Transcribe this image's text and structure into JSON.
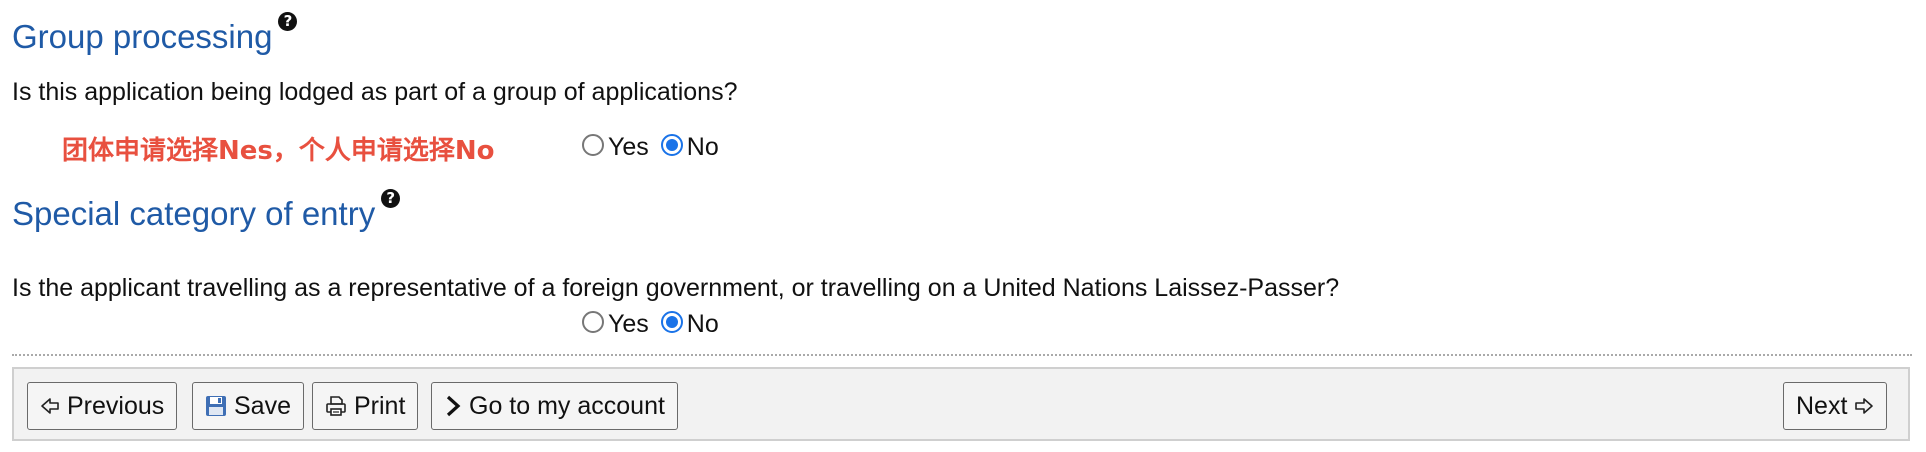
{
  "group_processing": {
    "title": "Group processing",
    "help_glyph": "?",
    "question": "Is this application being lodged as part of a group of applications?",
    "annotation": "团体申请选择Nes，个人申请选择No",
    "options": [
      {
        "label": "Yes",
        "checked": false
      },
      {
        "label": "No",
        "checked": true
      }
    ]
  },
  "special_category": {
    "title": "Special category of entry",
    "help_glyph": "?",
    "question": "Is the applicant travelling as a representative of a foreign government, or travelling on a United Nations Laissez-Passer?",
    "options": [
      {
        "label": "Yes",
        "checked": false
      },
      {
        "label": "No",
        "checked": true
      }
    ]
  },
  "toolbar": {
    "previous_label": "Previous",
    "save_label": "Save",
    "print_label": "Print",
    "account_label": "Go to my account",
    "next_label": "Next"
  },
  "colors": {
    "heading": "#1f5aa6",
    "annotation": "#e8503f",
    "radio_checked": "#1a73e8"
  },
  "icons": {
    "previous": "arrow-left-icon",
    "save": "floppy-disk-icon",
    "print": "printer-icon",
    "account": "chevron-right-icon",
    "next": "arrow-right-icon",
    "help": "help-icon"
  }
}
